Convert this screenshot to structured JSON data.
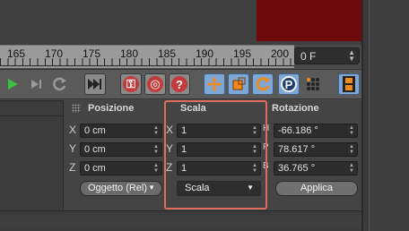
{
  "timeline": {
    "ruler_numbers": [
      "165",
      "170",
      "175",
      "180",
      "185",
      "190",
      "195",
      "200"
    ],
    "current_frame": "0 F"
  },
  "toolbar": {
    "icons": [
      "play-icon",
      "next-key-icon",
      "loop-icon",
      "goto-end-icon",
      "record-key-icon",
      "auto-key-icon",
      "help-icon",
      "move-icon",
      "scale-icon",
      "rotate-icon",
      "position-key-icon",
      "points-key-icon",
      "film-icon"
    ]
  },
  "coordinates": {
    "headers": {
      "position": "Posizione",
      "scale": "Scala",
      "rotation": "Rotazione"
    },
    "axes": [
      "X",
      "Y",
      "Z"
    ],
    "rotation_axes": [
      "H",
      "P",
      "B"
    ],
    "position": [
      "0 cm",
      "0 cm",
      "0 cm"
    ],
    "scale": [
      "1",
      "1",
      "1"
    ],
    "rotation": [
      "-66.186 °",
      "78.617 °",
      "36.765 °"
    ],
    "position_mode": "Oggetto (Rel)",
    "scale_mode": "Scala",
    "apply_label": "Applica"
  },
  "colors": {
    "highlight": "#e26a5a",
    "viewport_red": "#6e0a0a",
    "toolbar_blue": "#7fa7d6"
  }
}
